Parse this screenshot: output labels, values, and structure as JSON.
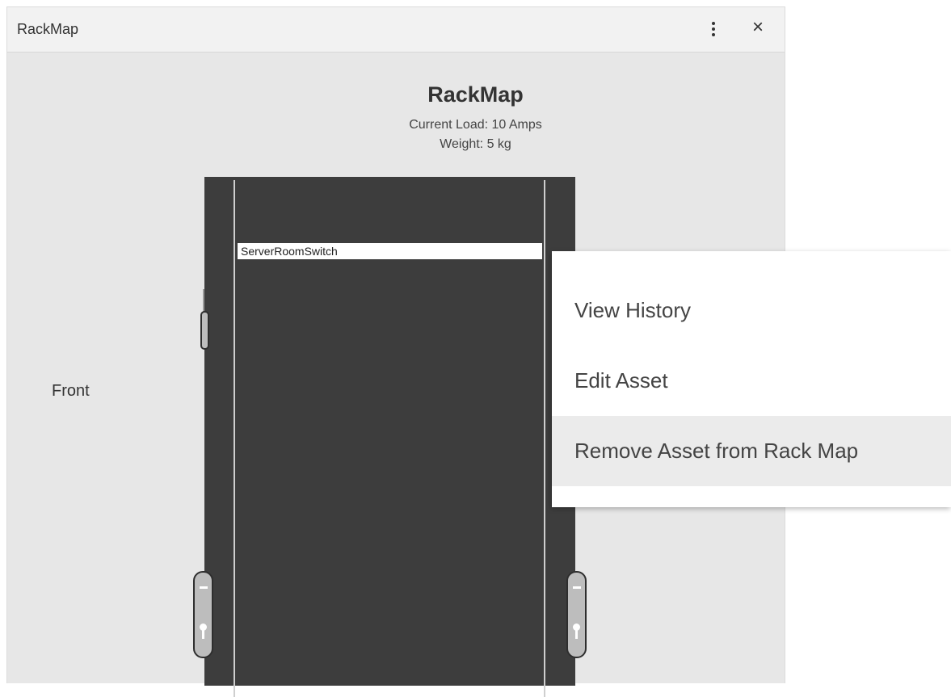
{
  "window": {
    "title": "RackMap"
  },
  "rack": {
    "title": "RackMap",
    "current_load": "Current Load: 10 Amps",
    "weight": "Weight: 5 kg",
    "side_label": "Front",
    "assets": [
      {
        "name": "ServerRoomSwitch"
      }
    ]
  },
  "context_menu": {
    "items": [
      {
        "label": "View History"
      },
      {
        "label": "Edit Asset"
      },
      {
        "label": "Remove Asset from Rack Map",
        "highlighted": true
      }
    ]
  },
  "icons": {
    "more": "vertical-dots-icon",
    "close": "close-icon",
    "close_glyph": "×"
  }
}
